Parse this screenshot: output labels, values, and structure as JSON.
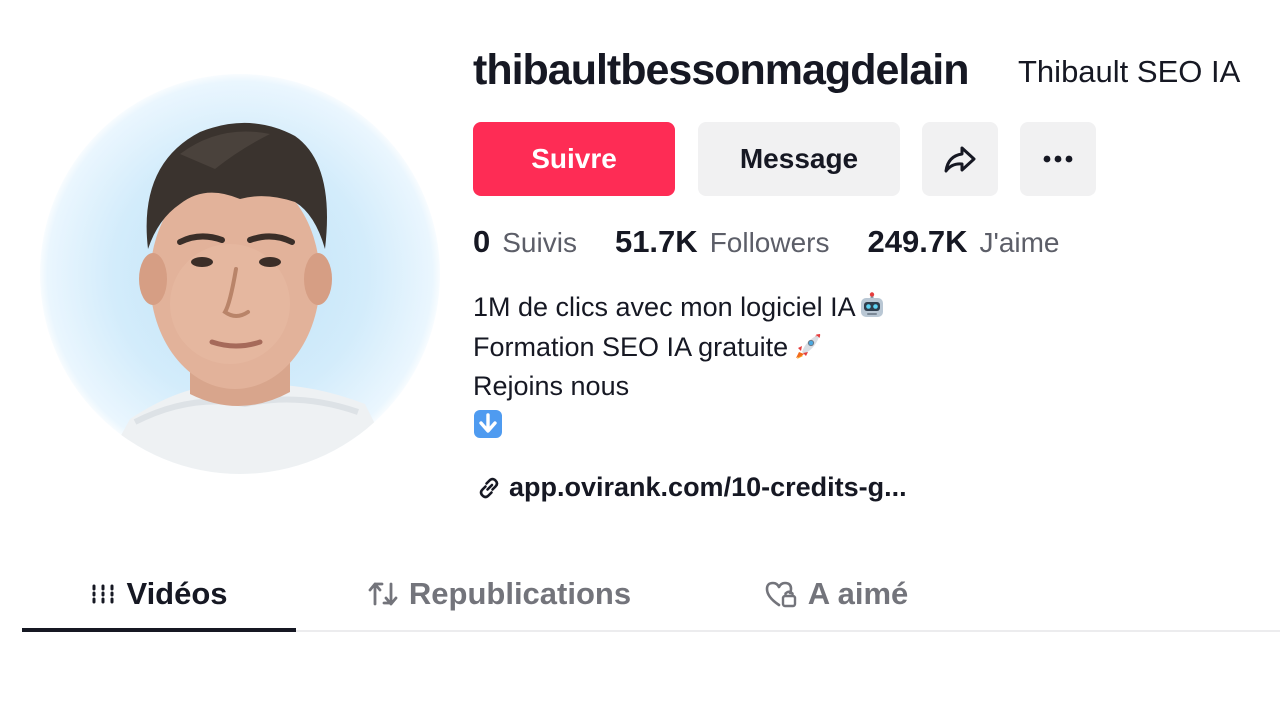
{
  "profile": {
    "username": "thibaultbessonmagdelain",
    "nickname": "Thibault SEO IA"
  },
  "actions": {
    "follow_label": "Suivre",
    "message_label": "Message",
    "share_icon": "share-icon",
    "more_icon": "more-icon"
  },
  "stats": {
    "following_count": "0",
    "following_label": "Suivis",
    "followers_count": "51.7K",
    "followers_label": "Followers",
    "likes_count": "249.7K",
    "likes_label": "J'aime"
  },
  "bio": {
    "line1": "1M de clics avec mon logiciel IA",
    "line1_emoji": "robot-emoji",
    "line2": "Formation SEO IA gratuite",
    "line2_emoji": "rocket-emoji",
    "line3": "Rejoins nous",
    "line4_emoji": "down-arrow-emoji"
  },
  "link": {
    "text": "app.ovirank.com/10-credits-g..."
  },
  "tabs": [
    {
      "label": "Vidéos",
      "icon": "grid-icon",
      "active": true
    },
    {
      "label": "Republications",
      "icon": "repost-icon",
      "active": false
    },
    {
      "label": "A aimé",
      "icon": "heart-lock-icon",
      "active": false
    }
  ],
  "colors": {
    "accent": "#fe2c55",
    "button_secondary": "#f1f1f2",
    "text_primary": "#161823",
    "text_secondary": "#73747b"
  }
}
